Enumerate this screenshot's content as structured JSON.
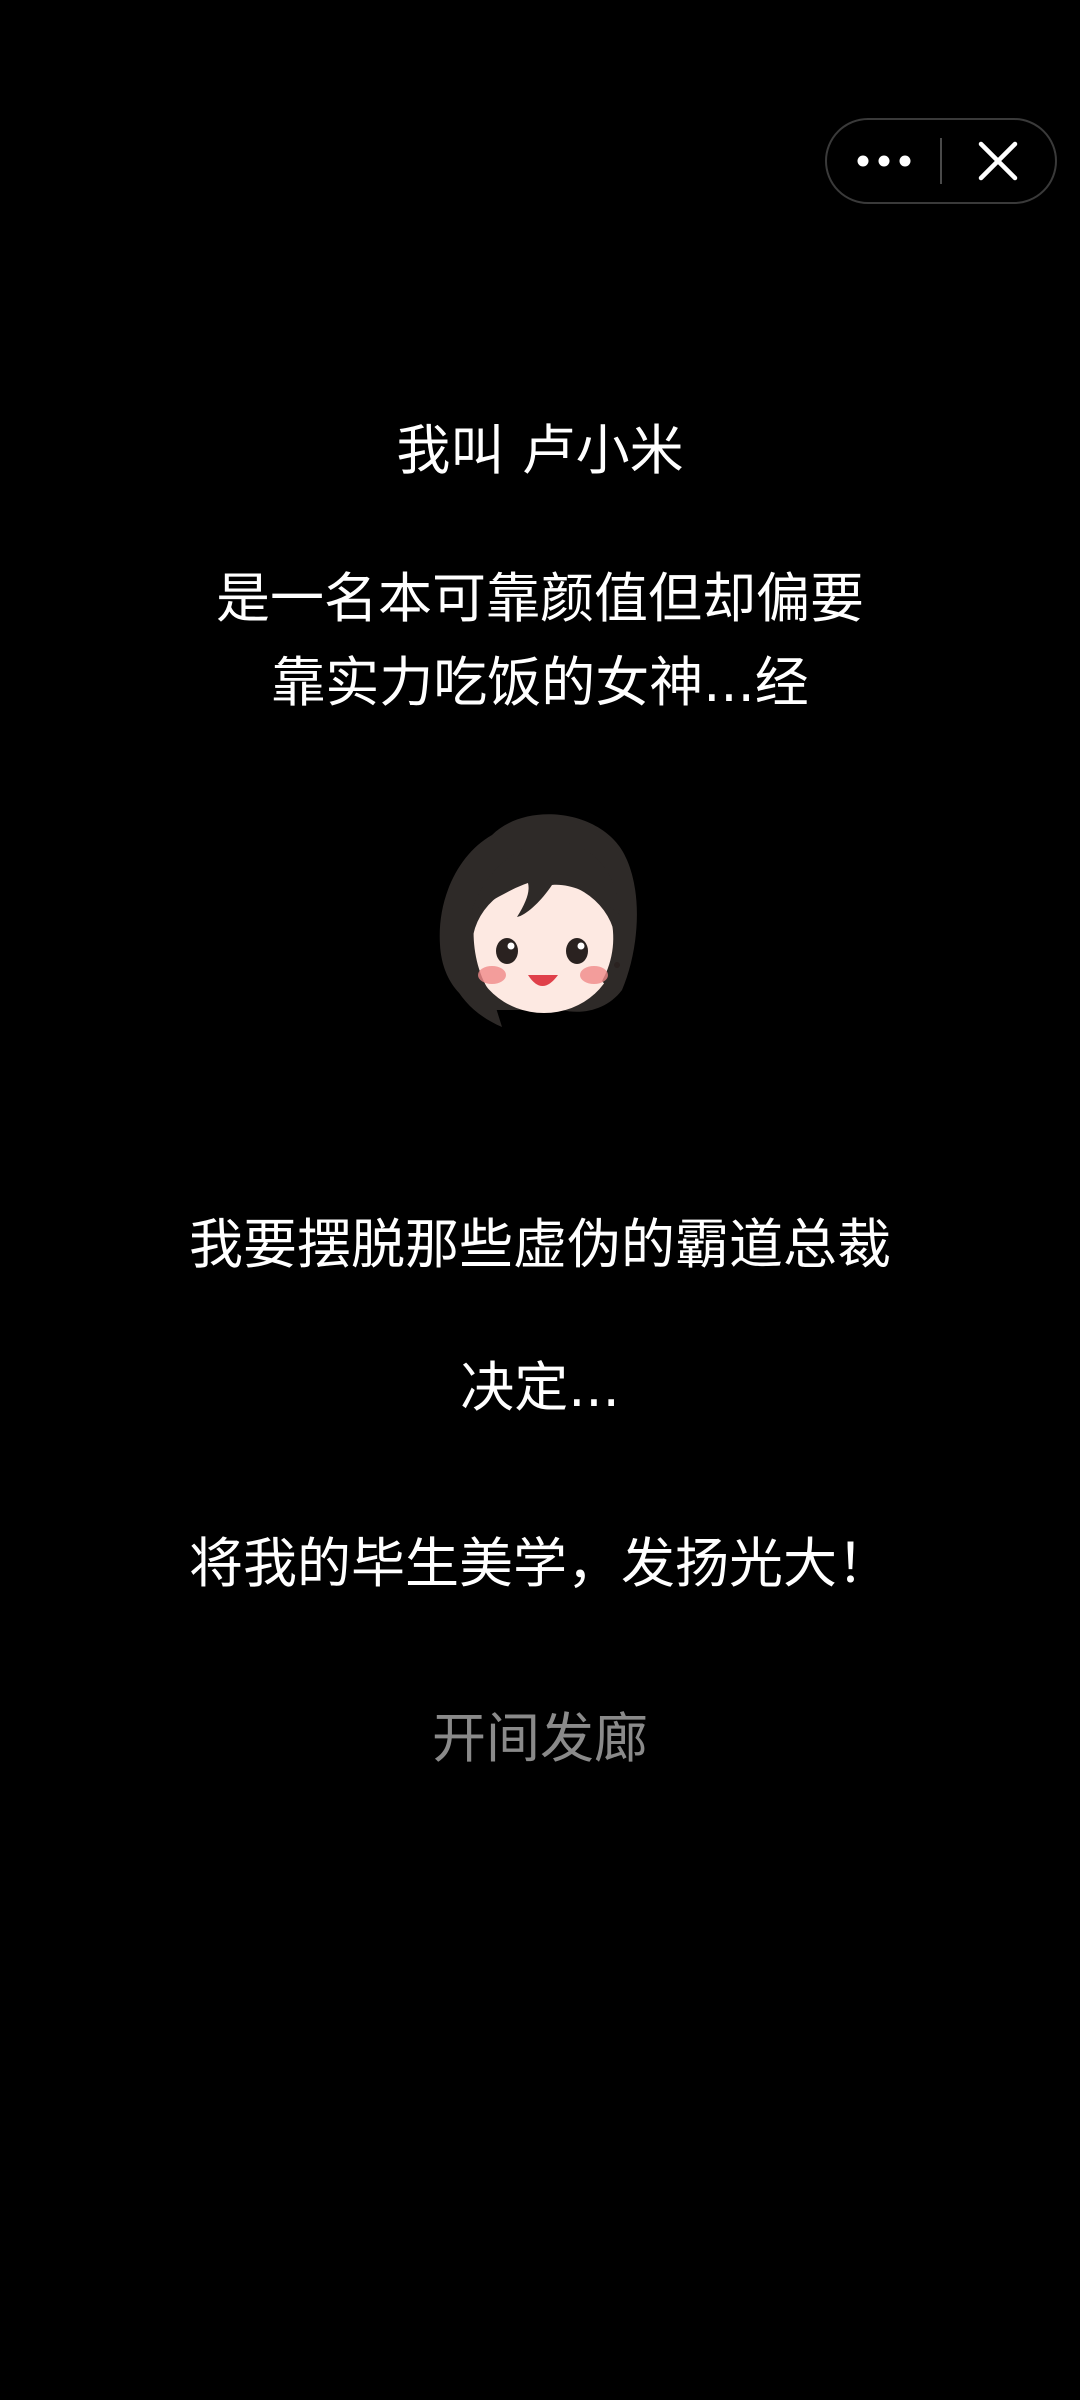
{
  "capsule": {
    "more_icon": "more-dots-icon",
    "close_icon": "close-icon"
  },
  "story": {
    "line1": "我叫 卢小米",
    "line2": "是一名本可靠颜值但却偏要",
    "line3": "靠实力吃饭的女神...经",
    "line4": "我要摆脱那些虚伪的霸道总裁",
    "line5": "决定...",
    "line6": "将我的毕生美学，发扬光大！",
    "line7": "开间发廊"
  },
  "avatar": {
    "icon": "girl-avatar-icon"
  },
  "colors": {
    "background": "#000000",
    "text": "#ffffff",
    "dim_text": "#8a8a8a",
    "hair": "#2e2a28",
    "skin": "#fde9e2",
    "cheek": "#f08a8a",
    "mouth": "#e0404a"
  }
}
